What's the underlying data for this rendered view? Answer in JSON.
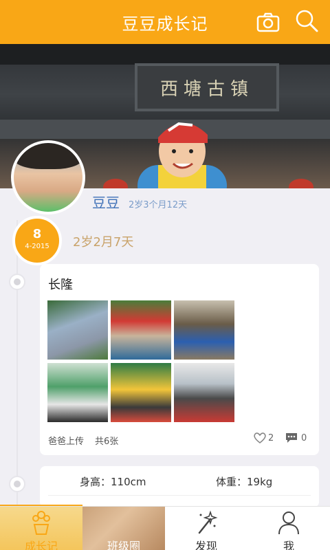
{
  "app": {
    "title": "豆豆成长记"
  },
  "icons": {
    "camera": "camera-icon",
    "search": "search-icon"
  },
  "hero": {
    "sign_text": "西塘古镇"
  },
  "profile": {
    "name": "豆豆",
    "age": "2岁3个月12天"
  },
  "entry": {
    "day": "8",
    "month_year": "4-2015",
    "age_label": "2岁2月7天",
    "title": "长隆",
    "uploader": "爸爸上传",
    "photo_count": "共6张",
    "likes": "2",
    "comments": "0"
  },
  "stats": {
    "height_label": "身高：110cm",
    "weight_label": "体重：19kg"
  },
  "tabs": [
    {
      "label": "成长记",
      "icon": "flower-pot-icon",
      "active": true
    },
    {
      "label": "班级圈",
      "icon": "class-circle-icon",
      "active": false
    },
    {
      "label": "发现",
      "icon": "magic-wand-icon",
      "active": false
    },
    {
      "label": "我",
      "icon": "person-icon",
      "active": false
    }
  ],
  "colors": {
    "accent": "#f9a716",
    "name": "#3d6fb6",
    "age_label": "#c9a36a"
  }
}
